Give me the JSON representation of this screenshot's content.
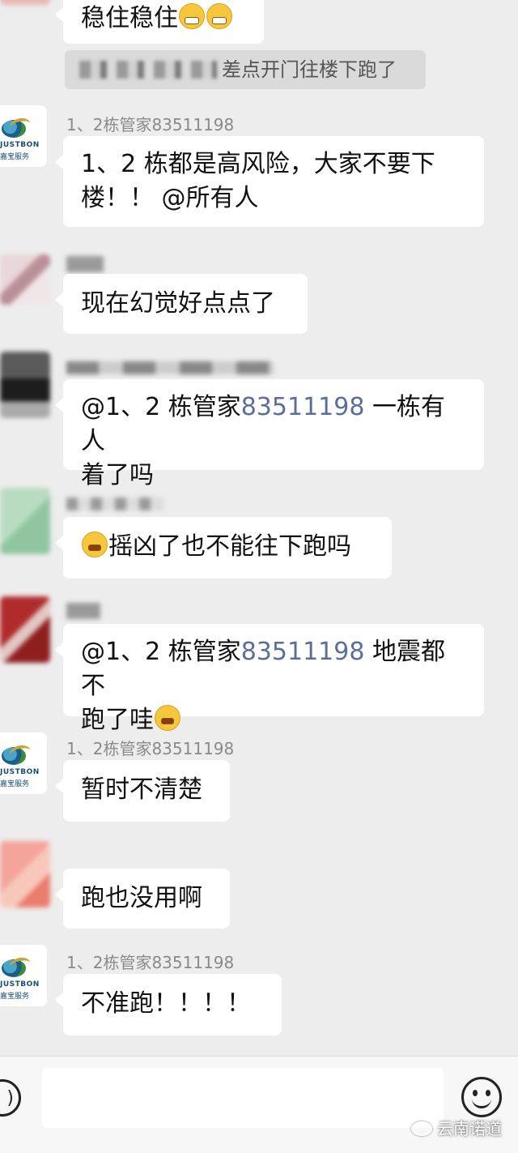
{
  "messages": [
    {
      "text": "稳住稳住",
      "emoji": "grin-emoji"
    },
    {
      "sys_text": "差点开门往楼下跑了"
    },
    {
      "sender": "1、2栋管家83511198",
      "line1": "1、2 栋都是高风险，大家不要下",
      "line2": "楼！！ @所有人"
    },
    {
      "text": "现在幻觉好点点了"
    },
    {
      "line1_mention": "@1、2 栋管家",
      "line1_number": "83511198",
      "line1_rest": " 一栋有人",
      "line2": "着了吗"
    },
    {
      "text": "摇凶了也不能往下跑吗",
      "emoji": "facepalm-emoji"
    },
    {
      "line1_mention": "@1、2 栋管家",
      "line1_number": "83511198",
      "line1_rest": " 地震都不",
      "line2": "跑了哇",
      "emoji": "facepalm-emoji"
    },
    {
      "sender": "1、2栋管家83511198",
      "text": "暂时不清楚"
    },
    {
      "text": "跑也没用啊"
    },
    {
      "sender": "1、2栋管家83511198",
      "text": "不准跑！！！！"
    }
  ],
  "logo": {
    "line1": "JUSTBON",
    "line2": "嘉宝服务"
  },
  "colors": {
    "background": "#ededed",
    "bubble": "#ffffff",
    "mention": "#5b6e9b",
    "sender": "#8a8a8a"
  },
  "watermark": "云南诺道"
}
